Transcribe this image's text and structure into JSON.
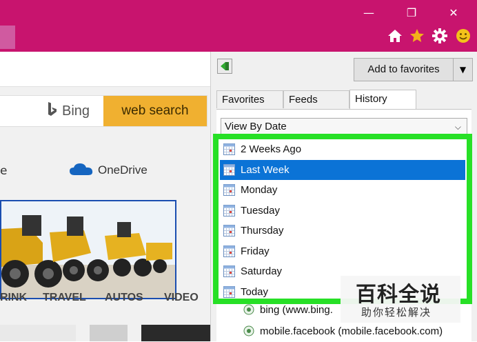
{
  "window": {
    "controls": {
      "minimize": "—",
      "maximize": "❐",
      "close": "✕"
    },
    "toolbar_icons": [
      "home-icon",
      "star-icon",
      "gear-icon",
      "smiley-icon"
    ],
    "accent_color": "#c8146e"
  },
  "page": {
    "bing_label": "Bing",
    "search_button": "web search",
    "e_fragment": "e",
    "onedrive_label": "OneDrive",
    "categories": [
      "RINK",
      "TRAVEL",
      "AUTOS",
      "VIDEO"
    ]
  },
  "panel": {
    "add_to_favorites": "Add to favorites",
    "tabs": [
      "Favorites",
      "Feeds",
      "History"
    ],
    "active_tab": "History",
    "view_select": "View By Date",
    "history_items": [
      {
        "label": "2 Weeks Ago",
        "selected": false
      },
      {
        "label": "Last Week",
        "selected": true
      },
      {
        "label": "Monday",
        "selected": false
      },
      {
        "label": "Tuesday",
        "selected": false
      },
      {
        "label": "Thursday",
        "selected": false
      },
      {
        "label": "Friday",
        "selected": false
      },
      {
        "label": "Saturday",
        "selected": false
      },
      {
        "label": "Today",
        "selected": false
      }
    ],
    "site_entries": [
      "bing (www.bing.",
      "mobile.facebook (mobile.facebook.com)"
    ],
    "highlight_color": "#27e026",
    "selection_color": "#0b73d6"
  },
  "watermark": {
    "title": "百科全说",
    "subtitle": "助你轻松解决"
  }
}
